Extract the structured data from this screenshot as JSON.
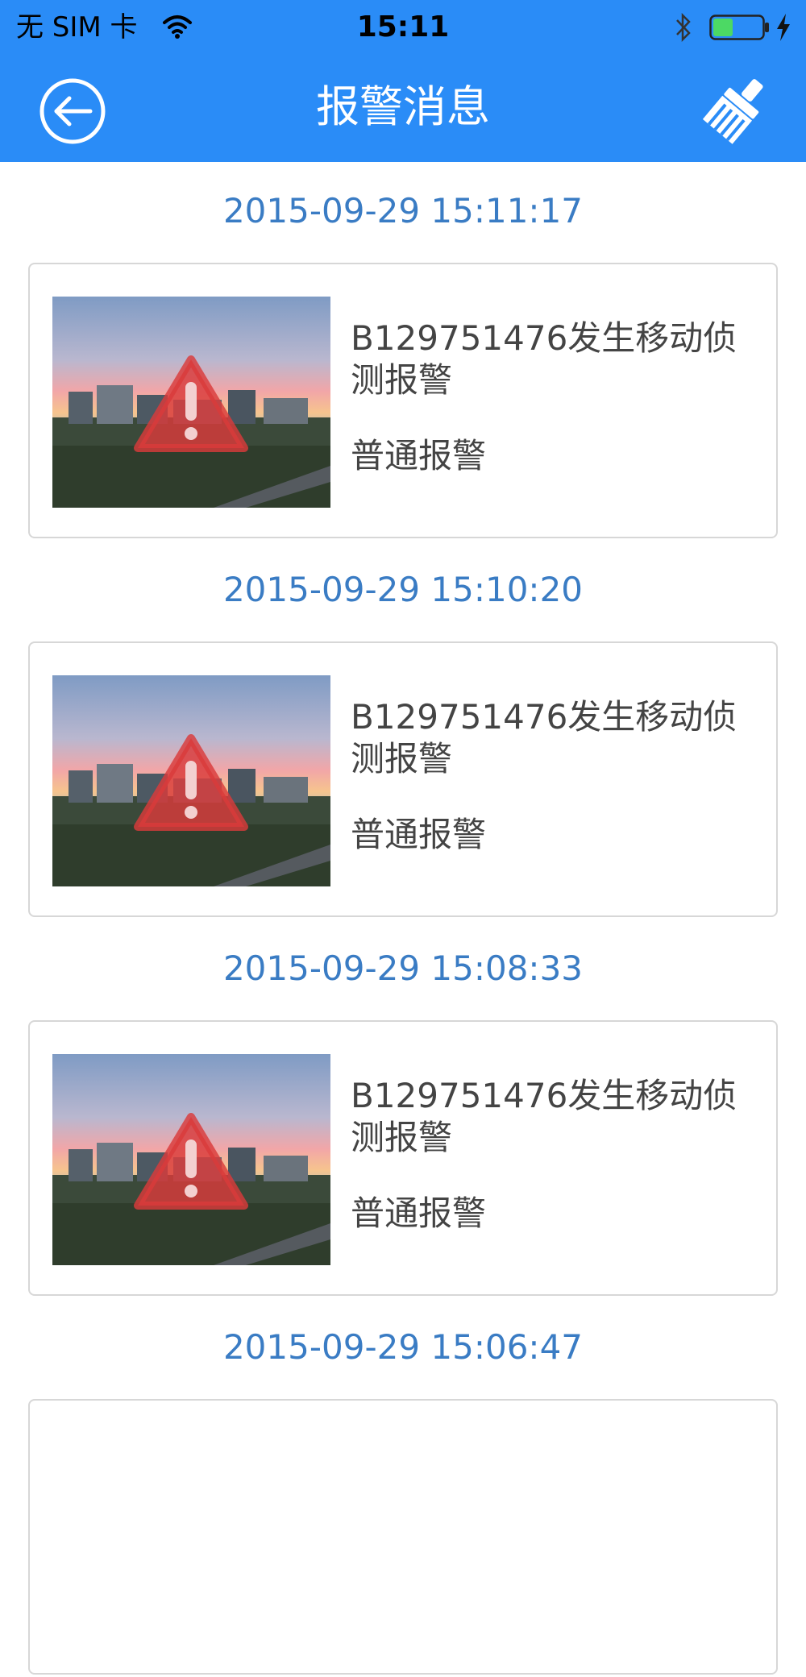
{
  "status_bar": {
    "carrier": "无 SIM 卡",
    "time": "15:11",
    "wifi_icon": "wifi-icon",
    "bluetooth_icon": "bluetooth-icon",
    "battery_icon": "battery-icon",
    "battery_color": "#4cd964"
  },
  "nav": {
    "title": "报警消息",
    "back_icon": "back-arrow-icon",
    "clear_icon": "broom-clear-icon",
    "bar_color": "#2a8cf7"
  },
  "alarms": [
    {
      "time": "2015-09-29 15:11:17",
      "message": "B129751476发生移动侦测报警",
      "type": "普通报警"
    },
    {
      "time": "2015-09-29 15:10:20",
      "message": "B129751476发生移动侦测报警",
      "type": "普通报警"
    },
    {
      "time": "2015-09-29 15:08:33",
      "message": "B129751476发生移动侦测报警",
      "type": "普通报警"
    },
    {
      "time": "2015-09-29 15:06:47"
    }
  ],
  "colors": {
    "timestamp": "#3a7cc4",
    "warning": "#d93a3a"
  }
}
